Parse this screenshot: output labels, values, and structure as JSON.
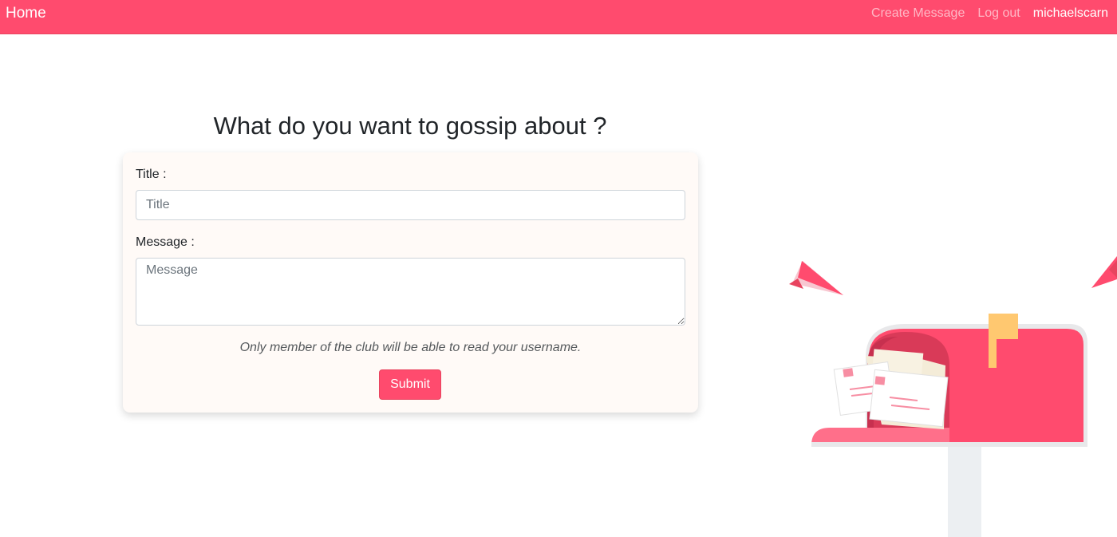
{
  "navbar": {
    "brand": "Home",
    "links": [
      {
        "label": "Create Message"
      },
      {
        "label": "Log out"
      }
    ],
    "username": "michaelscarn"
  },
  "page": {
    "heading": "What do you want to gossip about ?"
  },
  "form": {
    "title_label": "Title :",
    "title_placeholder": "Title",
    "title_value": "",
    "message_label": "Message :",
    "message_placeholder": "Message",
    "message_value": "",
    "note": "Only member of the club will be able to read your username.",
    "submit_label": "Submit"
  },
  "colors": {
    "accent": "#ff4b6e",
    "card_background": "#fffaf7",
    "flag": "#ffc870"
  },
  "illustration": {
    "icons": [
      "paper-plane-icon",
      "mailbox-icon",
      "envelope-icon",
      "flag-icon"
    ]
  }
}
